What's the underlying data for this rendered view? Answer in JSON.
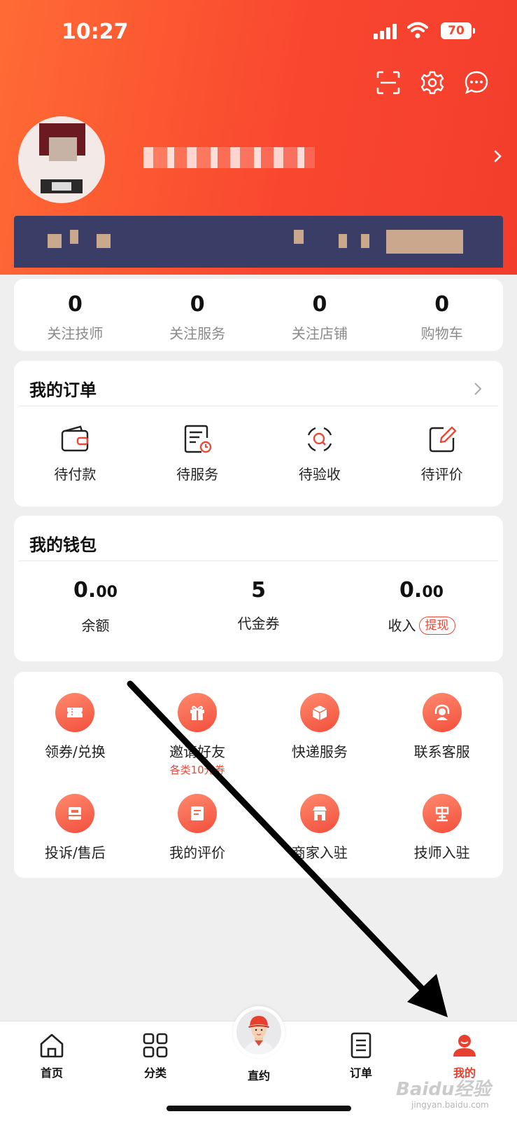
{
  "status_bar": {
    "time": "10:27",
    "battery": "70"
  },
  "header": {
    "icons": [
      "scan-icon",
      "gear-icon",
      "message-icon"
    ]
  },
  "stats": [
    {
      "value": "0",
      "label": "关注技师"
    },
    {
      "value": "0",
      "label": "关注服务"
    },
    {
      "value": "0",
      "label": "关注店铺"
    },
    {
      "value": "0",
      "label": "购物车"
    }
  ],
  "orders": {
    "title": "我的订单",
    "items": [
      {
        "label": "待付款",
        "icon": "wallet-icon"
      },
      {
        "label": "待服务",
        "icon": "checklist-clock-icon"
      },
      {
        "label": "待验收",
        "icon": "search-scan-icon"
      },
      {
        "label": "待评价",
        "icon": "edit-icon"
      }
    ]
  },
  "wallet": {
    "title": "我的钱包",
    "balance": {
      "int": "0.",
      "dec": "00",
      "label": "余额"
    },
    "vouchers": {
      "value": "5",
      "label": "代金券"
    },
    "income": {
      "int": "0.",
      "dec": "00",
      "label": "收入",
      "action": "提现"
    }
  },
  "services": {
    "row1": [
      {
        "label": "领券/兑换",
        "icon": "ticket-icon"
      },
      {
        "label": "邀请好友",
        "sub": "各类10元券",
        "icon": "gift-icon"
      },
      {
        "label": "快递服务",
        "icon": "package-icon"
      },
      {
        "label": "联系客服",
        "icon": "headset-icon"
      }
    ],
    "row2": [
      {
        "label": "投诉/售后",
        "icon": "inbox-icon"
      },
      {
        "label": "我的评价",
        "icon": "review-icon"
      },
      {
        "label": "商家入驻",
        "icon": "store-icon"
      },
      {
        "label": "技师入驻",
        "icon": "technician-icon"
      }
    ]
  },
  "tabbar": {
    "home": "首页",
    "category": "分类",
    "direct": "直约",
    "orders": "订单",
    "mine": "我的"
  },
  "watermark": {
    "text": "Baidu经验",
    "sub": "jingyan.baidu.com"
  },
  "colors": {
    "accent": "#f9472f",
    "tab_active": "#e8402f",
    "banner": "#3a3e66"
  }
}
